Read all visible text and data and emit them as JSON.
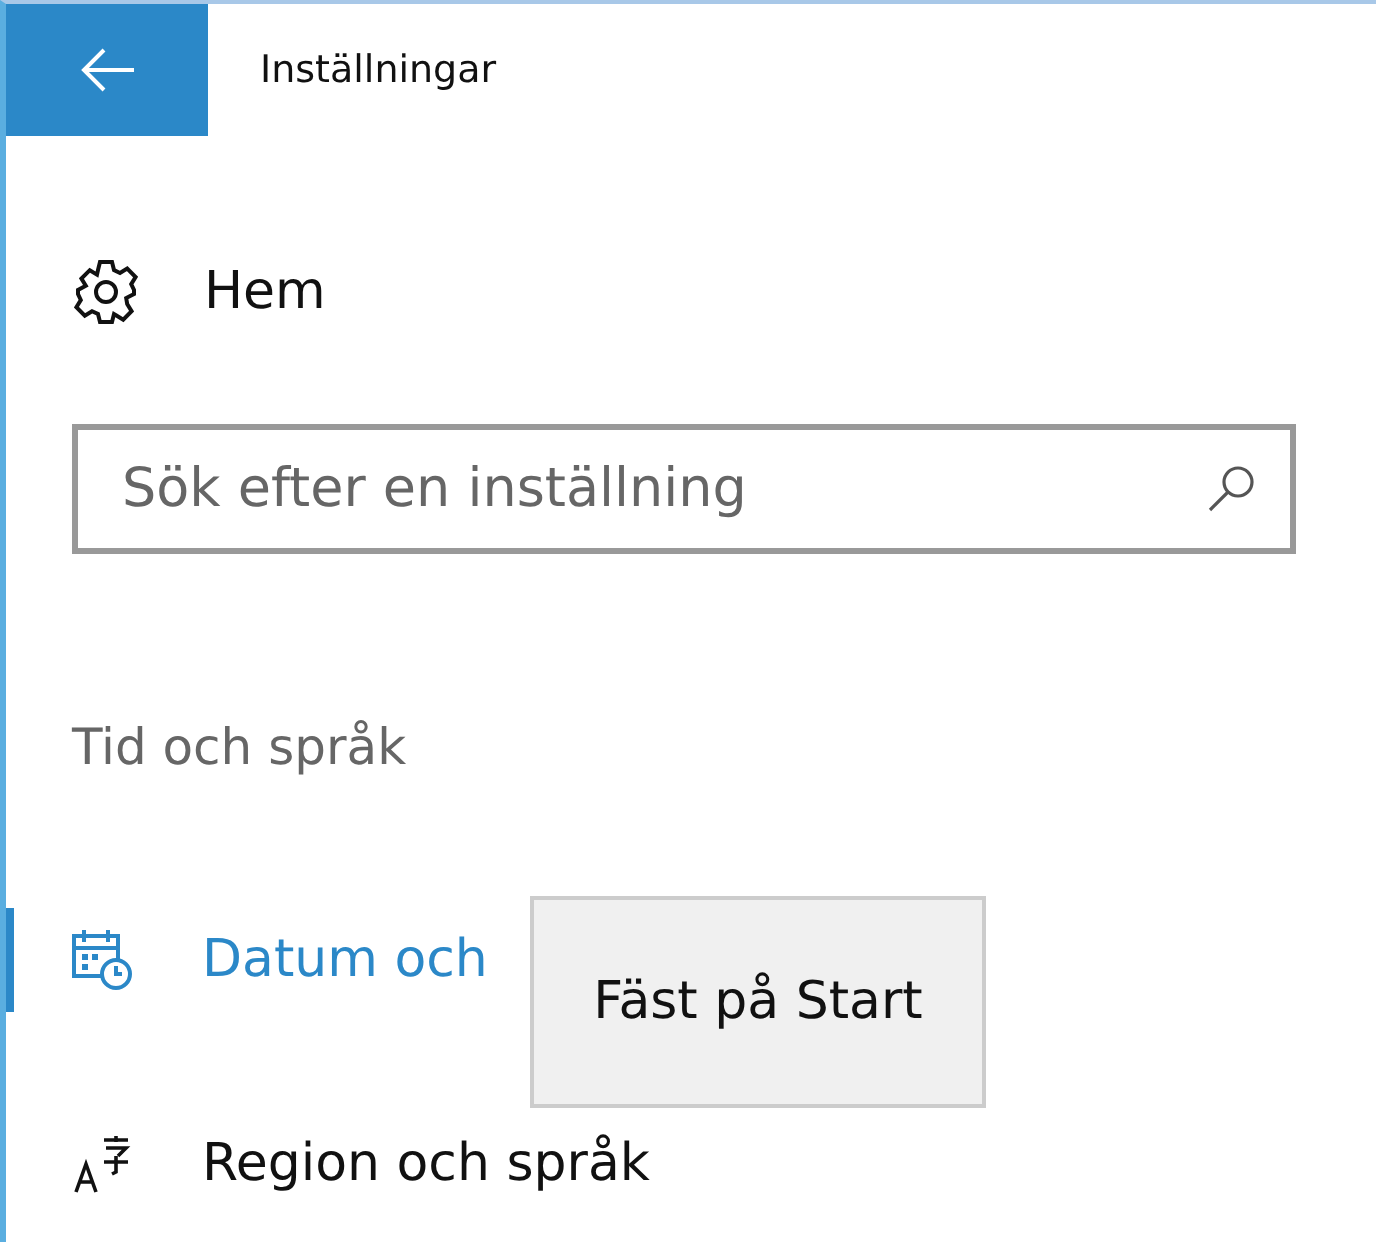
{
  "window": {
    "title": "Inställningar"
  },
  "home": {
    "label": "Hem"
  },
  "search": {
    "placeholder": "Sök efter en inställning"
  },
  "section": {
    "heading": "Tid och språk"
  },
  "nav_items": [
    {
      "label": "Datum och",
      "kind": "calendar",
      "selected": true
    },
    {
      "label": "Region och språk",
      "kind": "language",
      "selected": false
    }
  ],
  "context_menu": {
    "items": [
      "Fäst på Start"
    ]
  }
}
